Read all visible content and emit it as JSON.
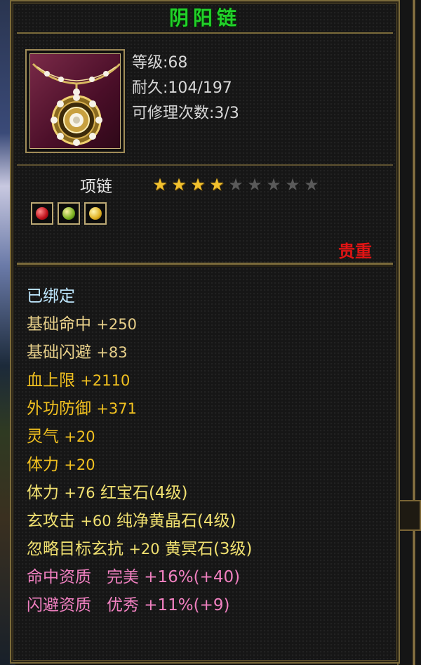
{
  "item": {
    "name": "阴阳链",
    "level": "等级:68",
    "durability": "耐久:104/197",
    "repair_count": "可修理次数:3/3",
    "type": "项链",
    "rarity": "贵重"
  },
  "stars": {
    "filled": 4,
    "total": 9
  },
  "gems": [
    "red-gem-icon",
    "green-gem-icon",
    "yellow-gem-icon"
  ],
  "colors": {
    "title": "#22d12a",
    "bound": "#bfe8ff",
    "base_stat": "#e8d08a",
    "bonus_stat": "#f0c020",
    "gem_stat": "#f0e070",
    "aptitude": "#f080c0",
    "rarity": "#e01414"
  },
  "attributes": {
    "bound": "已绑定",
    "lines": [
      {
        "label": "基础命中",
        "value": "+250",
        "extra": "",
        "kind": "base_stat"
      },
      {
        "label": "基础闪避",
        "value": "+83",
        "extra": "",
        "kind": "base_stat"
      },
      {
        "label": "血上限",
        "value": "+2110",
        "extra": "",
        "kind": "bonus_stat"
      },
      {
        "label": "外功防御",
        "value": "+371",
        "extra": "",
        "kind": "bonus_stat"
      },
      {
        "label": "灵气",
        "value": "+20",
        "extra": "",
        "kind": "bonus_stat"
      },
      {
        "label": "体力",
        "value": "+20",
        "extra": "",
        "kind": "bonus_stat"
      },
      {
        "label": "体力",
        "value": "+76",
        "extra": "红宝石(4级)",
        "kind": "gem_stat"
      },
      {
        "label": "玄攻击",
        "value": "+60",
        "extra": "纯净黄晶石(4级)",
        "kind": "gem_stat"
      },
      {
        "label": "忽略目标玄抗",
        "value": "+20",
        "extra": "黄冥石(3级)",
        "kind": "gem_stat"
      },
      {
        "label": "命中资质",
        "value": "完美",
        "extra": "+16%(+40)",
        "kind": "aptitude"
      },
      {
        "label": "闪避资质",
        "value": "优秀",
        "extra": "+11%(+9)",
        "kind": "aptitude"
      }
    ]
  }
}
